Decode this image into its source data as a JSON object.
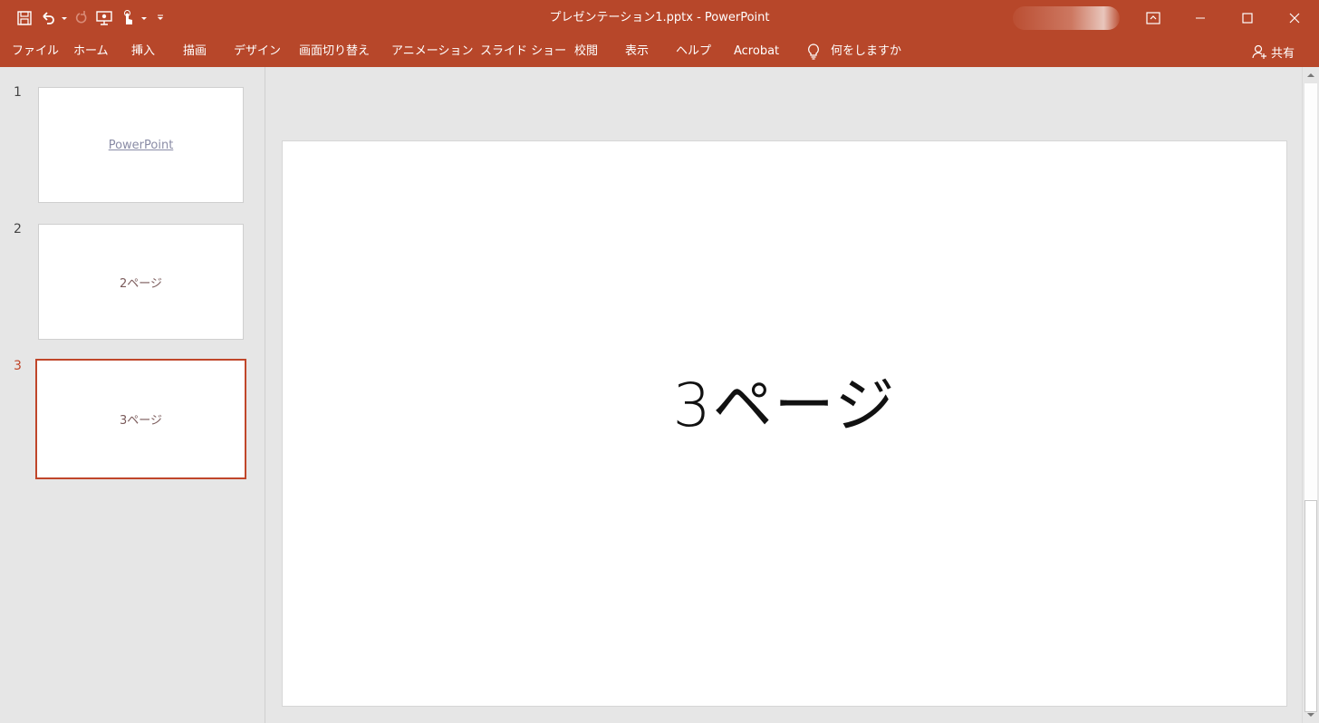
{
  "window": {
    "title": "プレゼンテーション1.pptx  -  PowerPoint",
    "accent_color": "#b7472a"
  },
  "qat": {
    "icons": [
      "save-icon",
      "undo-icon",
      "redo-icon",
      "present-icon",
      "touch-mode-icon",
      "customize-icon"
    ]
  },
  "ribbon": {
    "tabs": [
      "ファイル",
      "ホーム",
      "挿入",
      "描画",
      "デザイン",
      "画面切り替え",
      "アニメーション",
      "スライド ショー",
      "校閲",
      "表示",
      "ヘルプ",
      "Acrobat"
    ],
    "tell_me": "何をしますか",
    "share": "共有"
  },
  "thumbnails": [
    {
      "number": "1",
      "text": "PowerPoint"
    },
    {
      "number": "2",
      "text": "2ページ"
    },
    {
      "number": "3",
      "text": "3ページ"
    }
  ],
  "selected_slide": "3",
  "slide": {
    "title": "3ページ"
  }
}
